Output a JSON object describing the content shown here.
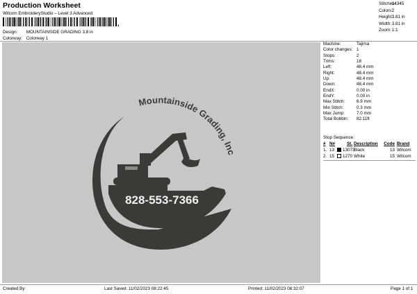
{
  "header": {
    "title": "Production Worksheet",
    "subtitle": "Wilcom EmbroideryStudio – Level 3 Advanced",
    "barcode_suffix": ",",
    "design_label": "Design:",
    "design_value": "MOUNTAINSIDE GRADING 3,8 in",
    "colorway_label": "Colorway:",
    "colorway_value": "Colorway 1"
  },
  "summary": [
    {
      "label": "Stitches:",
      "value": "14345"
    },
    {
      "label": "Colors:",
      "value": "2"
    },
    {
      "label": "Height:",
      "value": "3.81 in"
    },
    {
      "label": "Width:",
      "value": "3.81 in"
    },
    {
      "label": "Zoom:",
      "value": "1:1"
    }
  ],
  "design_art": {
    "arc_text": "Mountainside Grading, Inc",
    "phone": "828-553-7366",
    "thread_color": "#3a3a36",
    "text_color": "#f2f2f2"
  },
  "machine_info": [
    {
      "label": "Machine:",
      "value": "Tajima"
    },
    {
      "label": "Color changes:",
      "value": "1"
    },
    {
      "label": "Stops:",
      "value": "2"
    },
    {
      "label": "Trims:",
      "value": "18"
    },
    {
      "label": "Left:",
      "value": "48.4 mm"
    },
    {
      "label": "Right:",
      "value": "48.4 mm"
    },
    {
      "label": "Up:",
      "value": "48.4 mm"
    },
    {
      "label": "Down:",
      "value": "48.4 mm"
    },
    {
      "label": "EndX:",
      "value": "0.00 in"
    },
    {
      "label": "EndY:",
      "value": "0.00 in"
    },
    {
      "label": "Max Stitch:",
      "value": "6.9 mm"
    },
    {
      "label": "Min Stitch:",
      "value": "0.3 mm"
    },
    {
      "label": "Max Jump:",
      "value": "7.0 mm"
    },
    {
      "label": "Total Bobbin:",
      "value": "82.11ft"
    }
  ],
  "stop_sequence": {
    "title": "Stop Sequence:",
    "columns": [
      "#",
      "N#",
      "",
      "St.",
      "Description",
      "Code",
      "Brand"
    ],
    "rows": [
      {
        "n": "1.",
        "id": "13",
        "color": "#000000",
        "stitches": "13073",
        "description": "Black",
        "code": "13",
        "brand": "Wilcom"
      },
      {
        "n": "2.",
        "id": "15",
        "color": "#ffffff",
        "stitches": "1270",
        "description": "White",
        "code": "15",
        "brand": "Wilcom"
      }
    ]
  },
  "footer": {
    "created_by": "Created By:",
    "last_saved": "Last Saved: 11/02/2023 08:22:45",
    "printed": "Printed: 11/02/2023 08:32:07",
    "page": "Page 1 of 1"
  }
}
